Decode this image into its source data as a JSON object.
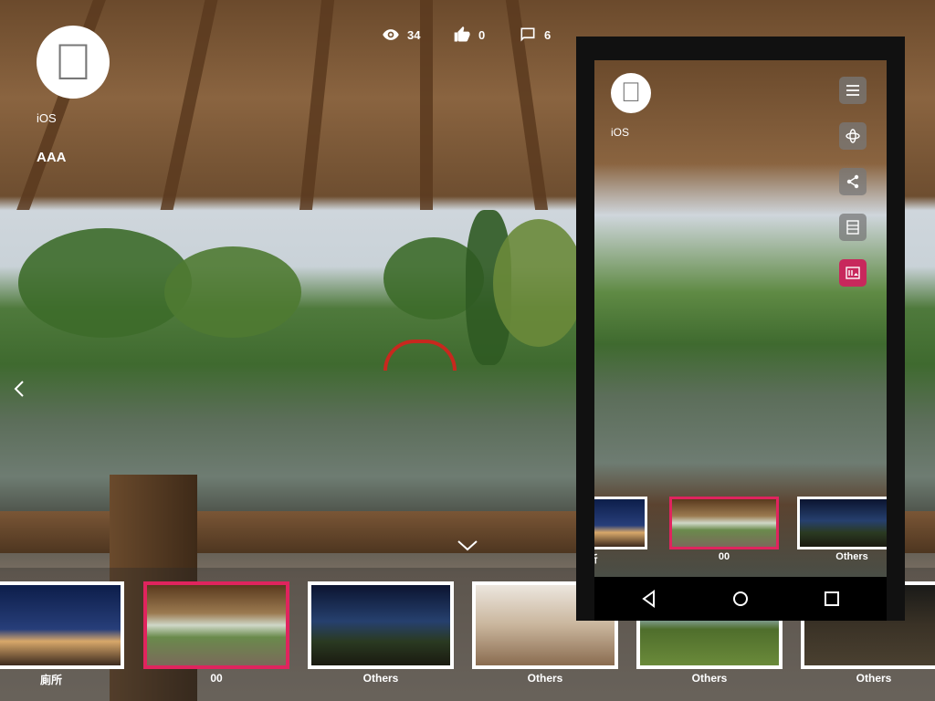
{
  "user": {
    "avatar_icon": "apple-logo-icon",
    "platform": "iOS",
    "name": "AAA"
  },
  "stats": {
    "views": "34",
    "likes": "0",
    "comments": "6"
  },
  "thumbnails": [
    {
      "label": "廁所",
      "theme": "night-tent",
      "active": false
    },
    {
      "label": "00",
      "theme": "gazebo",
      "active": true
    },
    {
      "label": "Others",
      "theme": "night-road",
      "active": false
    },
    {
      "label": "Others",
      "theme": "interior-room",
      "active": false
    },
    {
      "label": "Others",
      "theme": "river-bend",
      "active": false
    },
    {
      "label": "Others",
      "theme": "dark-interior",
      "active": false
    }
  ],
  "phone": {
    "platform": "iOS",
    "toolbar": [
      "menu-icon",
      "gyroscope-icon",
      "share-icon",
      "vr-view-icon",
      "gallery-icon"
    ],
    "thumbnails": [
      {
        "label": "所",
        "theme": "night-tent",
        "active": false
      },
      {
        "label": "00",
        "theme": "gazebo",
        "active": true
      },
      {
        "label": "Others",
        "theme": "night-road",
        "active": false
      }
    ],
    "nav": [
      "back-icon",
      "home-icon",
      "recents-icon"
    ]
  },
  "colors": {
    "accent": "#e0245e",
    "active_tool": "#c8285c",
    "phone_frame": "#111111"
  }
}
